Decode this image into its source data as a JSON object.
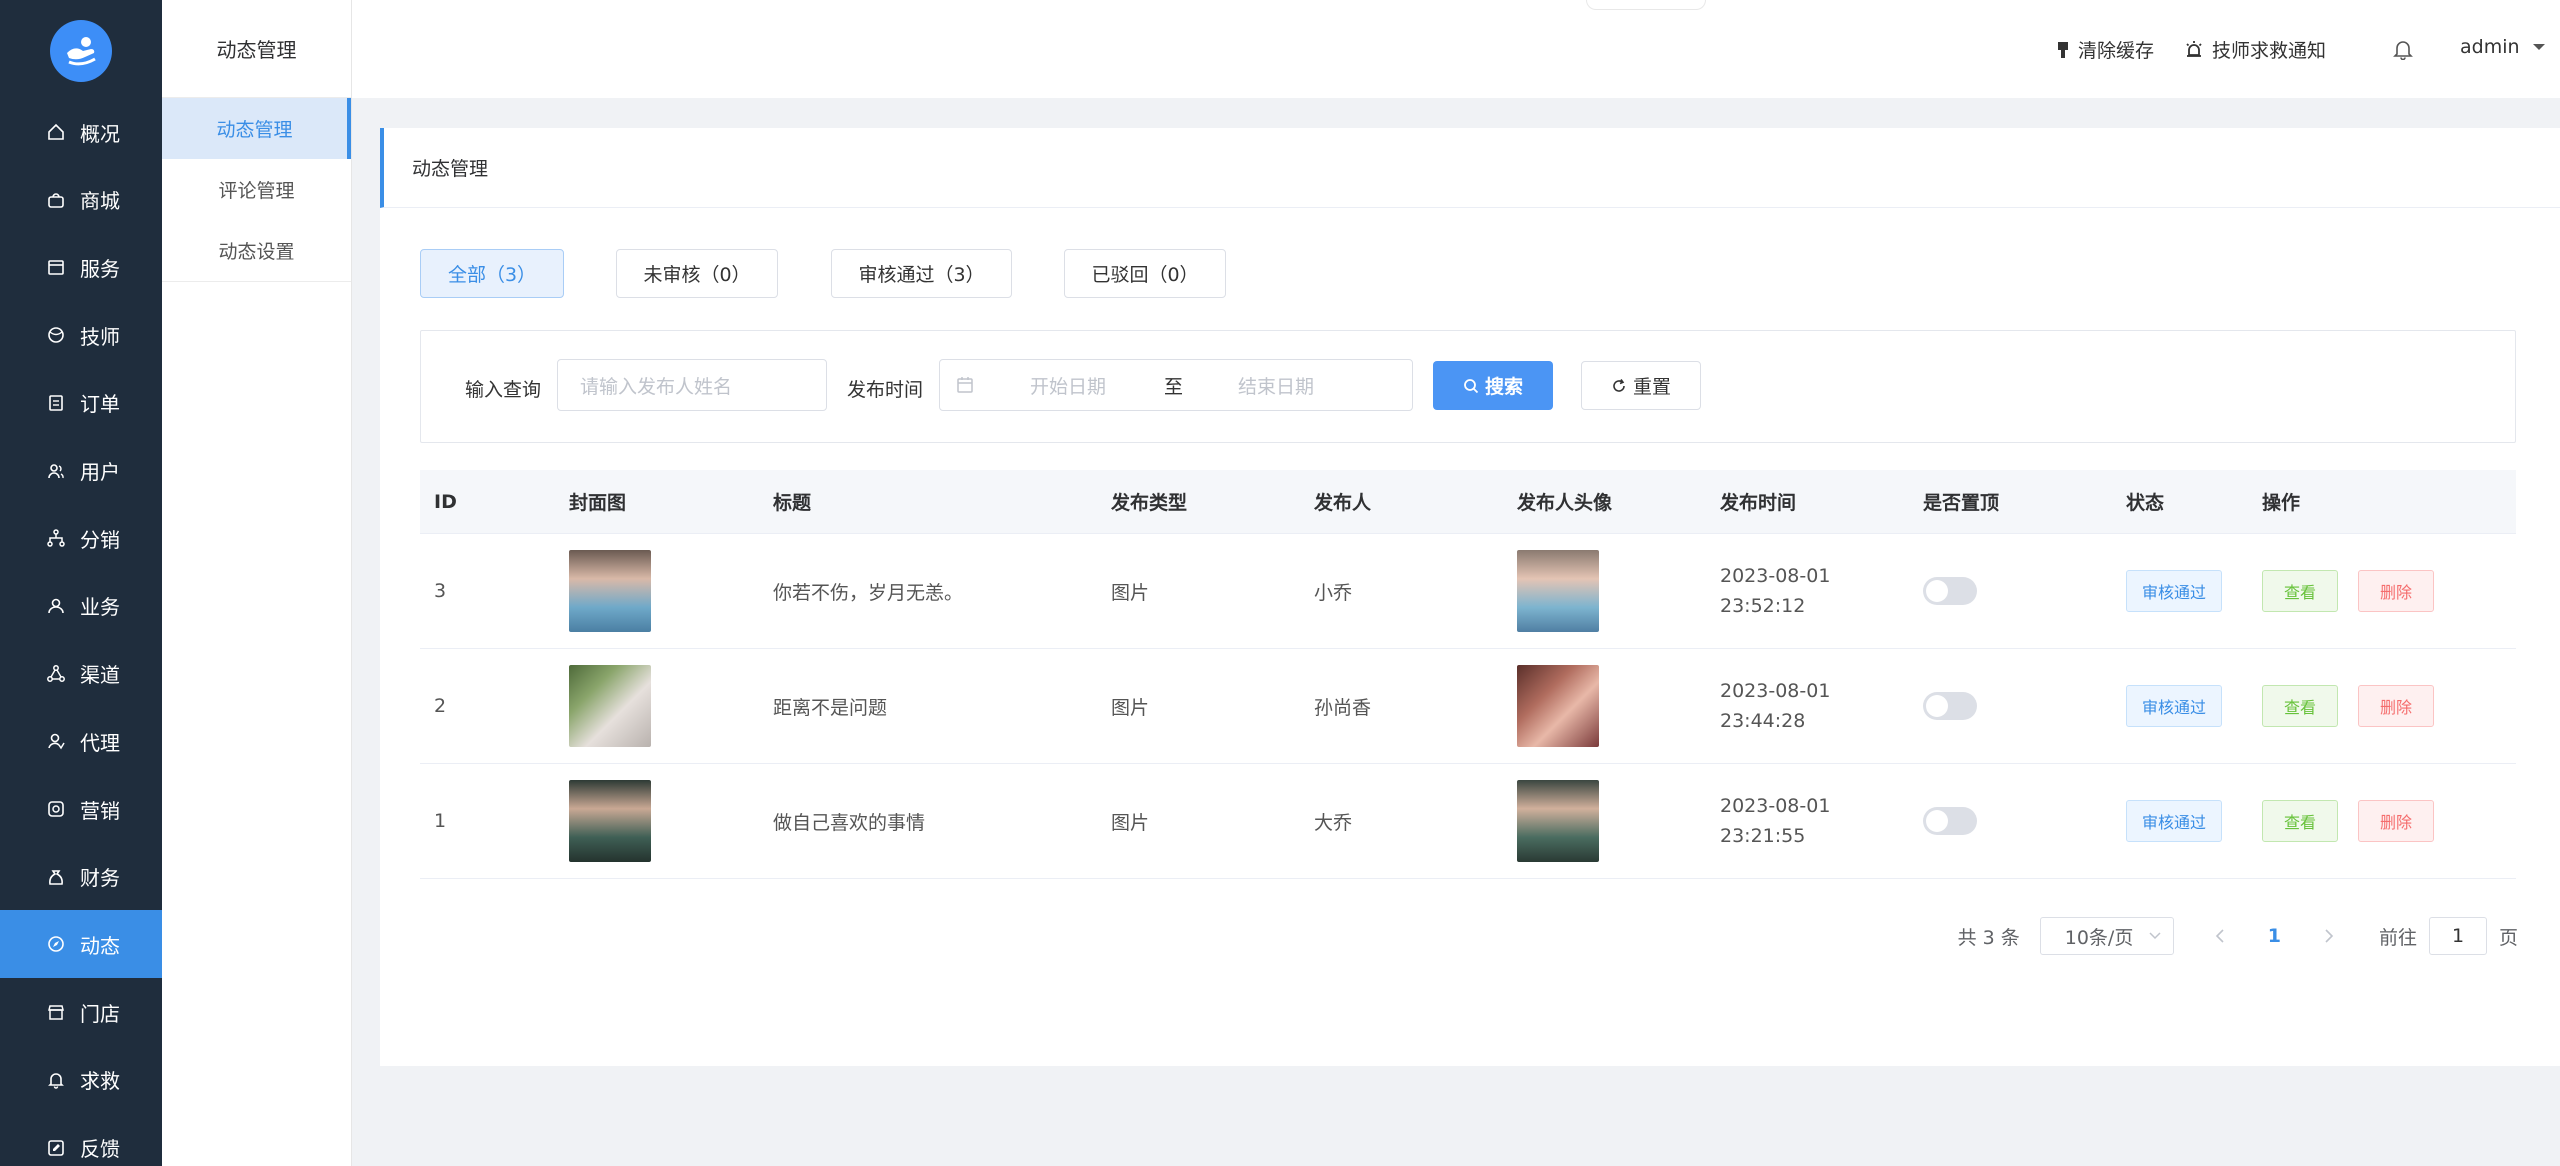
{
  "sidebar": {
    "items": [
      {
        "label": "概况",
        "icon": "home-icon"
      },
      {
        "label": "商城",
        "icon": "shopping-bag-icon"
      },
      {
        "label": "服务",
        "icon": "calendar-icon"
      },
      {
        "label": "技师",
        "icon": "basketball-icon"
      },
      {
        "label": "订单",
        "icon": "document-icon"
      },
      {
        "label": "用户",
        "icon": "users-icon"
      },
      {
        "label": "分销",
        "icon": "share-tree-icon"
      },
      {
        "label": "业务",
        "icon": "user-icon"
      },
      {
        "label": "渠道",
        "icon": "triangle-nodes-icon"
      },
      {
        "label": "代理",
        "icon": "agent-icon"
      },
      {
        "label": "营销",
        "icon": "marketing-icon"
      },
      {
        "label": "财务",
        "icon": "money-bag-icon"
      },
      {
        "label": "动态",
        "icon": "compass-icon"
      },
      {
        "label": "门店",
        "icon": "store-icon"
      },
      {
        "label": "求救",
        "icon": "bell-icon"
      },
      {
        "label": "反馈",
        "icon": "edit-icon"
      }
    ],
    "active_index": 12,
    "accent_color": "#3a8ee6",
    "bg_color": "#1f2d3d"
  },
  "subbar": {
    "title": "动态管理",
    "items": [
      {
        "label": "动态管理"
      },
      {
        "label": "评论管理"
      },
      {
        "label": "动态设置"
      }
    ]
  },
  "header": {
    "clear_cache": "清除缓存",
    "sos_notice": "技师求救通知",
    "user": "admin"
  },
  "panel": {
    "title": "动态管理",
    "tabs": [
      {
        "label": "全部（3）"
      },
      {
        "label": "未审核（0）"
      },
      {
        "label": "审核通过（3）"
      },
      {
        "label": "已驳回（0）"
      }
    ]
  },
  "filter": {
    "query_label": "输入查询",
    "query_placeholder": "请输入发布人姓名",
    "time_label": "发布时间",
    "start_placeholder": "开始日期",
    "range_separator": "至",
    "end_placeholder": "结束日期",
    "search_label": "搜索",
    "reset_label": "重置"
  },
  "table": {
    "columns": [
      "ID",
      "封面图",
      "标题",
      "发布类型",
      "发布人",
      "发布人头像",
      "发布时间",
      "是否置顶",
      "状态",
      "操作"
    ],
    "rows": [
      {
        "id": "3",
        "title": "你若不伤，岁月无恙。",
        "type": "图片",
        "publisher": "小乔",
        "date": "2023-08-01",
        "time": "23:52:12",
        "status": "审核通过",
        "view": "查看",
        "delete": "删除"
      },
      {
        "id": "2",
        "title": "距离不是问题",
        "type": "图片",
        "publisher": "孙尚香",
        "date": "2023-08-01",
        "time": "23:44:28",
        "status": "审核通过",
        "view": "查看",
        "delete": "删除"
      },
      {
        "id": "1",
        "title": "做自己喜欢的事情",
        "type": "图片",
        "publisher": "大乔",
        "date": "2023-08-01",
        "time": "23:21:55",
        "status": "审核通过",
        "view": "查看",
        "delete": "删除"
      }
    ]
  },
  "pagination": {
    "total": "共 3 条",
    "page_size": "10条/页",
    "current_page": "1",
    "goto_prefix": "前往",
    "goto_value": "1",
    "goto_suffix": "页"
  }
}
